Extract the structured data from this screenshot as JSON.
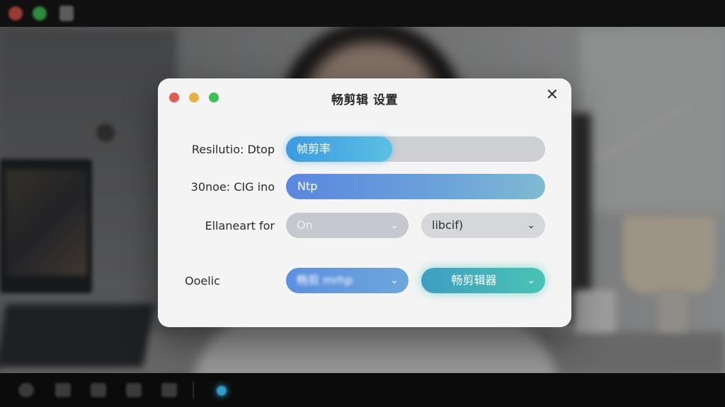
{
  "dialog": {
    "title": "畅剪辑 设置",
    "close_glyph": "✕",
    "rows": [
      {
        "label": "Resilutio: Dtop",
        "slider_label": "帧剪率",
        "slider_value_percent": 41
      },
      {
        "label": "30noe: CIG ino",
        "bar_label": "Ntp"
      },
      {
        "label": "Ellaneart for",
        "select_a": "On",
        "select_b": "libcif)"
      },
      {
        "label": "Ooelic",
        "select_c": "畅剪 mrhp",
        "select_d": "畅剪辑器"
      }
    ],
    "chevron_glyph": "⌄"
  },
  "accent_colors": {
    "close": "#e25a50",
    "minimize": "#e8b143",
    "maximize": "#3cc156",
    "primary_blue": "#5c8fe0",
    "teal": "#48c3b4"
  }
}
